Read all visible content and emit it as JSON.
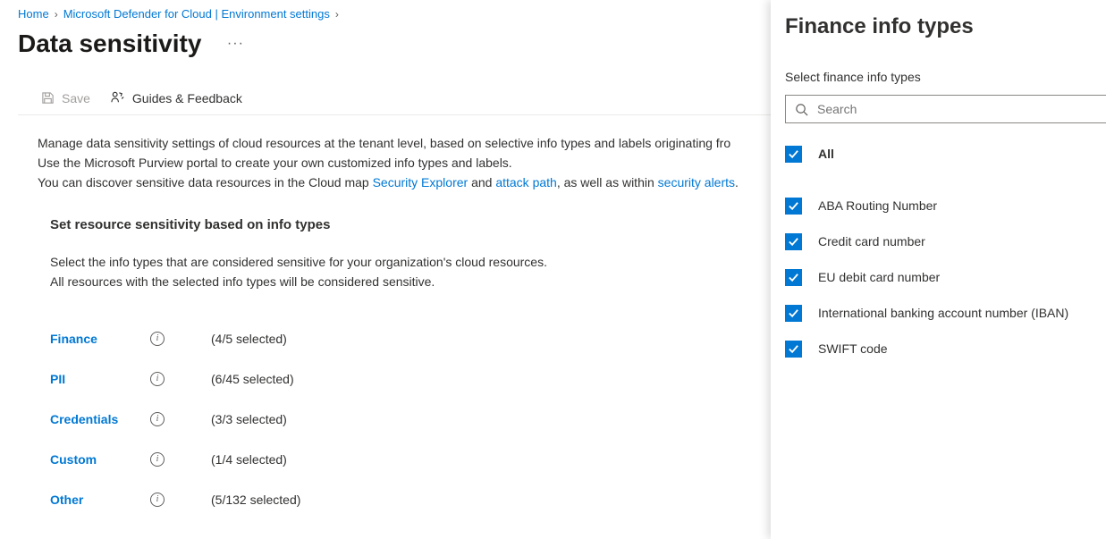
{
  "breadcrumb": {
    "home": "Home",
    "defender": "Microsoft Defender for Cloud | Environment settings"
  },
  "page_title": "Data sensitivity",
  "commands": {
    "save": "Save",
    "guides": "Guides & Feedback"
  },
  "description": {
    "line1_pre": "Manage data sensitivity settings of cloud resources at the tenant level, based on selective info types and labels originating fro",
    "line2": "Use the Microsoft Purview portal to create your own customized info types and labels.",
    "line3_pre": "You can discover sensitive data resources in the Cloud map ",
    "link_security_explorer": "Security Explorer",
    "line3_mid": " and ",
    "link_attack_path": "attack path",
    "line3_mid2": ", as well as within ",
    "link_security_alerts": "security alerts",
    "line3_end": "."
  },
  "section": {
    "heading": "Set resource sensitivity based on info types",
    "desc_line1": "Select the info types that are considered sensitive for your organization's cloud resources.",
    "desc_line2": "All resources with the selected info types will be considered sensitive."
  },
  "info_types": [
    {
      "label": "Finance",
      "count": "(4/5 selected)"
    },
    {
      "label": "PII",
      "count": "(6/45 selected)"
    },
    {
      "label": "Credentials",
      "count": "(3/3 selected)"
    },
    {
      "label": "Custom",
      "count": "(1/4 selected)"
    },
    {
      "label": "Other",
      "count": "(5/132 selected)"
    }
  ],
  "panel": {
    "title": "Finance info types",
    "subtitle": "Select finance info types",
    "search_placeholder": "Search",
    "all_label": "All",
    "items": [
      {
        "label": "ABA Routing Number",
        "checked": true
      },
      {
        "label": "Credit card number",
        "checked": true
      },
      {
        "label": "EU debit card number",
        "checked": true
      },
      {
        "label": "International banking account number (IBAN)",
        "checked": true
      },
      {
        "label": "SWIFT code",
        "checked": true
      }
    ]
  }
}
